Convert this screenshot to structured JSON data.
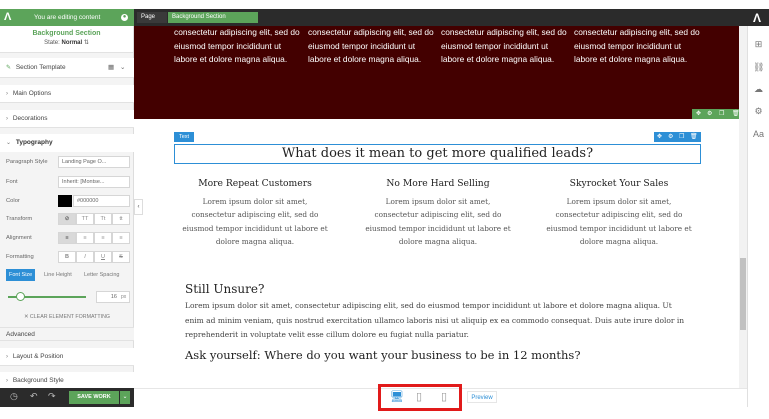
{
  "topbar": {
    "editing_label": "You are editing content",
    "crumb_page": "Page",
    "crumb_section": "Background Section"
  },
  "panel": {
    "title": "Background Section",
    "state_label": "State:",
    "state_value": "Normal",
    "section_template": "Section Template",
    "main_options": "Main Options",
    "decorations": "Decorations",
    "typography": "Typography",
    "paragraph_style_label": "Paragraph Style",
    "paragraph_style_value": "Landing Page O...",
    "font_label": "Font",
    "font_value": "Inherit: [Montse...",
    "color_label": "Color",
    "color_value": "#000000",
    "transform_label": "Transform",
    "transform_options": [
      "⊘",
      "TT",
      "Tt",
      "tt"
    ],
    "alignment_label": "Alignment",
    "formatting_label": "Formatting",
    "formatting_options": [
      "B",
      "I",
      "U",
      "S"
    ],
    "tabs": [
      "Font Size",
      "Line Height",
      "Letter Spacing"
    ],
    "font_size_value": "16",
    "font_size_unit": "px",
    "clear_formatting": "CLEAR ELEMENT FORMATTING",
    "advanced": "Advanced",
    "layout_position": "Layout & Position",
    "background_style": "Background Style"
  },
  "canvas": {
    "maroon_text": "consectetur adipiscing elit, sed do eiusmod tempor incididunt ut labore et dolore magna aliqua.",
    "text_tag": "Text",
    "heading": "What does it mean to get more qualified leads?",
    "columns": [
      {
        "title": "More Repeat Customers",
        "body": "Lorem ipsum dolor sit amet, consectetur adipiscing elit, sed do eiusmod tempor incididunt ut labore et dolore magna aliqua."
      },
      {
        "title": "No More Hard Selling",
        "body": "Lorem ipsum dolor sit amet, consectetur adipiscing elit, sed do eiusmod tempor incididunt ut labore et dolore magna aliqua."
      },
      {
        "title": "Skyrocket Your Sales",
        "body": "Lorem ipsum dolor sit amet, consectetur adipiscing elit, sed do eiusmod tempor incididunt ut labore et dolore magna aliqua."
      }
    ],
    "unsure_heading": "Still Unsure?",
    "unsure_body": "Lorem ipsum dolor sit amet, consectetur adipiscing elit, sed do eiusmod tempor incididunt ut labore et dolore magna aliqua. Ut enim ad minim veniam, quis nostrud exercitation ullamco laboris nisi ut aliquip ex ea commodo consequat. Duis aute irure dolor in reprehenderit in voluptate velit esse cillum dolore eu fugiat nulla pariatur.",
    "ask_heading": "Ask yourself: Where do you want your business to be in 12 months?"
  },
  "footer": {
    "save_label": "SAVE WORK",
    "preview_label": "Preview"
  },
  "colors": {
    "brand_green": "#5ca45a",
    "maroon": "#430000",
    "selection_blue": "#2d8fd6",
    "highlight_red": "#e11a1a"
  }
}
